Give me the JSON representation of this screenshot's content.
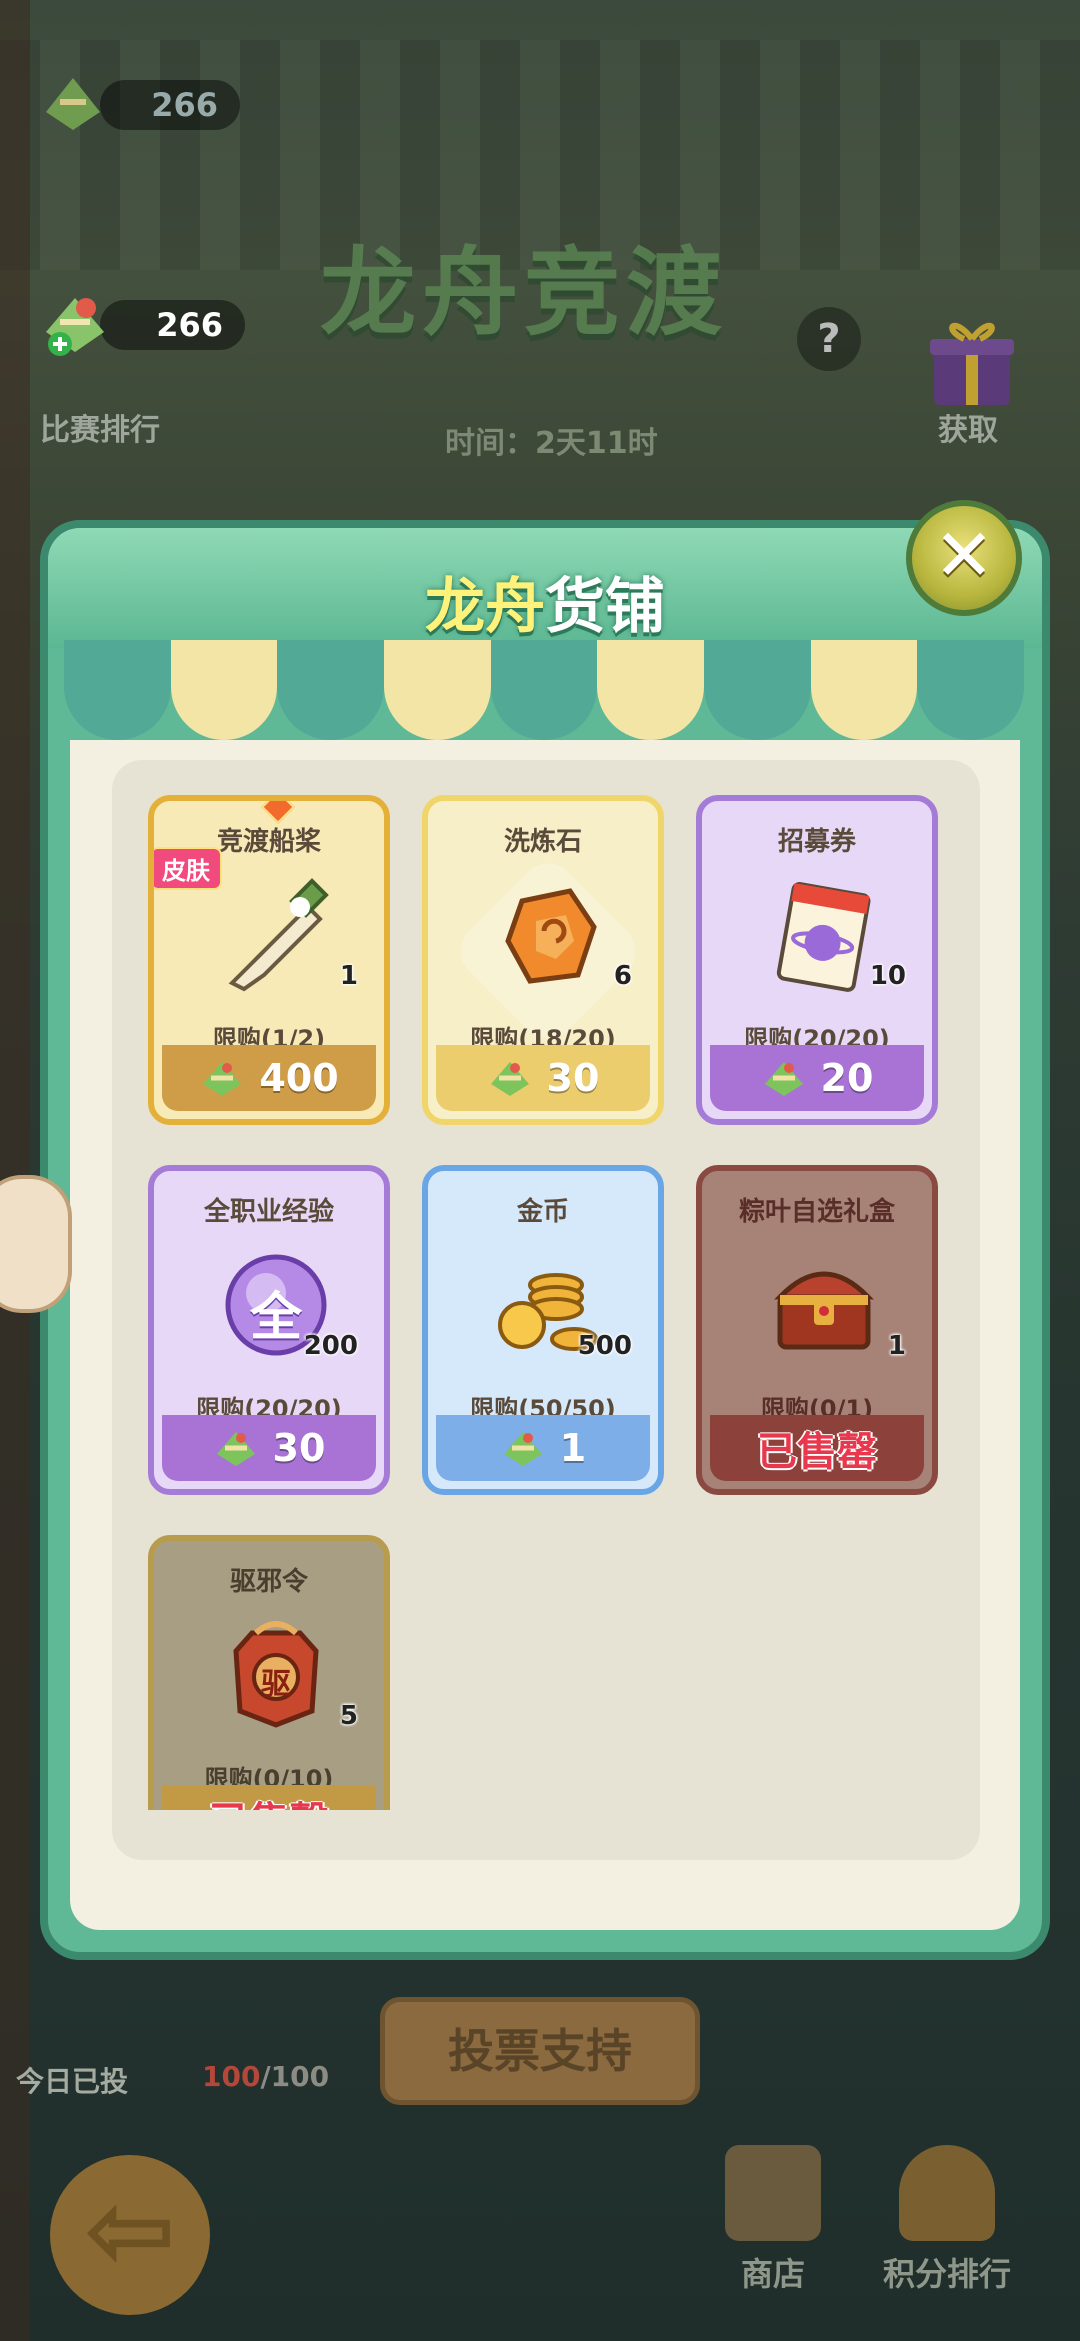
{
  "top": {
    "currency_top": "266",
    "currency": "266",
    "event_title": "龙舟竞渡",
    "help_icon": "question-icon",
    "rank_label": "比赛排行",
    "get_label": "获取",
    "timer_text": "时间：2天11时"
  },
  "shop": {
    "title_hl": "龙舟",
    "title_rest": "货铺",
    "close_icon": "close-icon",
    "items": [
      {
        "name": "竞渡船桨",
        "tag": "皮肤",
        "qty": "1",
        "limit": "限购(1/2)",
        "price": "400",
        "style": "gold",
        "icon": "oar-icon"
      },
      {
        "name": "洗炼石",
        "qty": "6",
        "limit": "限购(18/20)",
        "price": "30",
        "style": "yellow",
        "icon": "stone-icon"
      },
      {
        "name": "招募券",
        "qty": "10",
        "limit": "限购(20/20)",
        "price": "20",
        "style": "purple",
        "icon": "ticket-icon",
        "icon_text": "INTEGRAL"
      },
      {
        "name": "全职业经验",
        "qty": "200",
        "limit": "限购(20/20)",
        "price": "30",
        "style": "purple",
        "icon": "exp-orb-icon",
        "icon_text": "全"
      },
      {
        "name": "金币",
        "qty": "500",
        "limit": "限购(50/50)",
        "price": "1",
        "style": "blue",
        "icon": "coins-icon"
      },
      {
        "name": "粽叶自选礼盒",
        "qty": "1",
        "limit": "限购(0/1)",
        "price": "已售罄",
        "style": "red",
        "icon": "chest-icon"
      },
      {
        "name": "驱邪令",
        "qty": "5",
        "limit": "限购(0/10)",
        "price": "已售罄",
        "style": "grey",
        "icon": "token-icon",
        "icon_text": "驱"
      }
    ]
  },
  "bottom": {
    "vote_label": "投票支持",
    "today_label": "今日已投",
    "today_used": "100",
    "today_total": "/100",
    "back_icon": "back-arrow-icon",
    "nav": [
      {
        "label": "商店",
        "icon": "shop-icon"
      },
      {
        "label": "积分排行",
        "icon": "trophy-icon"
      }
    ]
  },
  "colors": {
    "accent_green": "#5fb896",
    "sold_out": "#e8384d",
    "title_highlight": "#fff27a"
  }
}
